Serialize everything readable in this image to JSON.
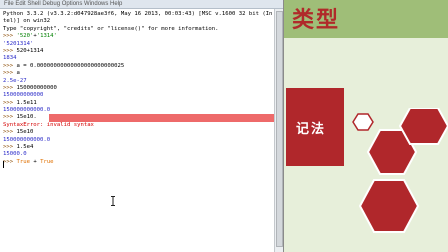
{
  "slide": {
    "title": "类型",
    "banner_text": "记法"
  },
  "window": {
    "menu_text": "File  Edit  Shell  Debug  Options  Windows  Help"
  },
  "shell": {
    "lines": [
      {
        "type": "banner",
        "text": "Python 3.3.2 (v3.3.2:d047928ae3f6, May 16 2013, 00:03:43) [MSC v.1600 32 bit (In"
      },
      {
        "type": "banner",
        "text": "tel)] on win32"
      },
      {
        "type": "banner",
        "text": "Type \"copyright\", \"credits\" or \"license()\" for more information."
      },
      {
        "type": "cmd",
        "prompt": ">>> ",
        "parts": [
          {
            "t": "'520'",
            "c": "str"
          },
          {
            "t": "+",
            "c": "input"
          },
          {
            "t": "'1314'",
            "c": "str"
          }
        ]
      },
      {
        "type": "out",
        "text": "'5201314'"
      },
      {
        "type": "cmd",
        "prompt": ">>> ",
        "parts": [
          {
            "t": "520+1314",
            "c": "input"
          }
        ]
      },
      {
        "type": "out",
        "text": "1834"
      },
      {
        "type": "cmd",
        "prompt": ">>> ",
        "parts": [
          {
            "t": "a = 0.00000000000000000000000025",
            "c": "input"
          }
        ]
      },
      {
        "type": "cmd",
        "prompt": ">>> ",
        "parts": [
          {
            "t": "a",
            "c": "input"
          }
        ]
      },
      {
        "type": "out",
        "text": "2.5e-27"
      },
      {
        "type": "cmd",
        "prompt": ">>> ",
        "parts": [
          {
            "t": "150000000000",
            "c": "input"
          }
        ]
      },
      {
        "type": "out",
        "text": "150000000000"
      },
      {
        "type": "cmd",
        "prompt": ">>> ",
        "parts": [
          {
            "t": "1.5e11",
            "c": "input"
          }
        ]
      },
      {
        "type": "out",
        "text": "150000000000.0"
      },
      {
        "type": "errcmd",
        "prompt": ">>> ",
        "parts": [
          {
            "t": "15e10.",
            "c": "input"
          }
        ]
      },
      {
        "type": "err",
        "text": "SyntaxError: invalid syntax"
      },
      {
        "type": "cmd",
        "prompt": ">>> ",
        "parts": [
          {
            "t": "15e10",
            "c": "input"
          }
        ]
      },
      {
        "type": "out",
        "text": "150000000000.0"
      },
      {
        "type": "cmd",
        "prompt": ">>> ",
        "parts": [
          {
            "t": "1.5e4",
            "c": "input"
          }
        ]
      },
      {
        "type": "out",
        "text": "15000.0"
      },
      {
        "type": "cmd",
        "prompt": ">>> ",
        "parts": [
          {
            "t": "True",
            "c": "kw"
          },
          {
            "t": " + ",
            "c": "input"
          },
          {
            "t": "True",
            "c": "kw"
          }
        ]
      }
    ]
  }
}
